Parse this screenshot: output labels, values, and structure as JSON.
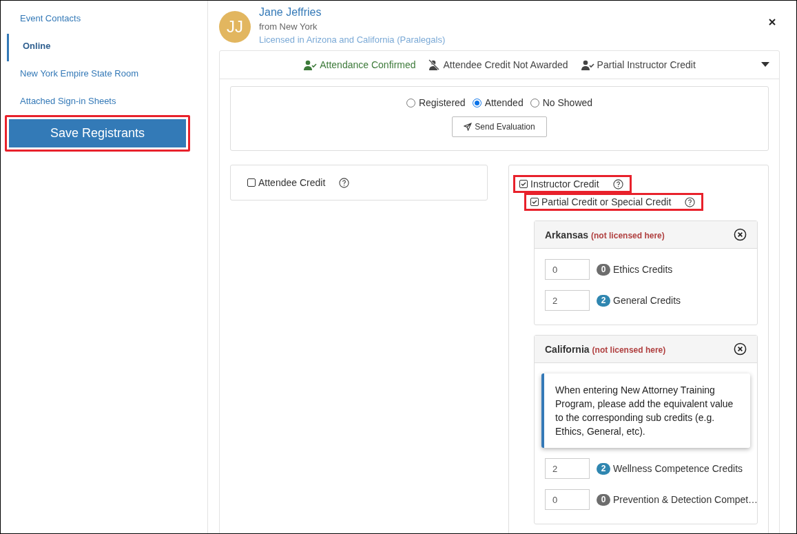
{
  "sidebar": {
    "items": [
      {
        "label": "Event Contacts",
        "selected": false
      },
      {
        "label": "Online",
        "selected": true
      },
      {
        "label": "New York Empire State Room",
        "selected": false
      },
      {
        "label": "Attached Sign-in Sheets",
        "selected": false
      }
    ],
    "save_button": {
      "label": "Save Registrants",
      "highlighted": true
    }
  },
  "registrant": {
    "initials": "JJ",
    "name": "Jane Jeffries",
    "location": "from New York",
    "license": "Licensed in Arizona and California (Paralegals)"
  },
  "status_items": [
    {
      "kind": "confirmed",
      "label": "Attendance Confirmed",
      "color": "#3d7a3a"
    },
    {
      "kind": "not-awarded",
      "label": "Attendee Credit Not Awarded",
      "color": "#444444"
    },
    {
      "kind": "partial",
      "label": "Partial Instructor Credit",
      "color": "#444444"
    }
  ],
  "attendance": [
    {
      "label": "Registered",
      "selected": false
    },
    {
      "label": "Attended",
      "selected": true
    },
    {
      "label": "No Showed",
      "selected": false
    }
  ],
  "send_evaluation": "Send Evaluation",
  "attendee_credit": {
    "label": "Attendee Credit",
    "checked": false
  },
  "instructor_credit": {
    "label": "Instructor Credit",
    "checked": true,
    "highlighted": true,
    "sub_option": {
      "label": "Partial Credit or Special Credit",
      "checked": true,
      "highlighted": true
    }
  },
  "states": [
    {
      "name": "Arkansas",
      "note": "(not licensed here)",
      "credits": [
        {
          "value": "0",
          "badge": "0",
          "label": "Ethics Credits",
          "color": "#6d6d6d"
        },
        {
          "value": "2",
          "badge": "2",
          "label": "General Credits",
          "color": "#2f86b0"
        }
      ]
    },
    {
      "name": "California",
      "note": "(not licensed here)",
      "notice": "When entering New Attorney Training Program, please add the equivalent value to the corresponding sub credits (e.g. Ethics, General, etc).",
      "credits": [
        {
          "value": "2",
          "badge": "2",
          "label": "Wellness Competence Credits",
          "color": "#2f86b0"
        },
        {
          "value": "0",
          "badge": "0",
          "label": "Prevention & Detection Compet…",
          "color": "#6d6d6d"
        }
      ]
    }
  ]
}
